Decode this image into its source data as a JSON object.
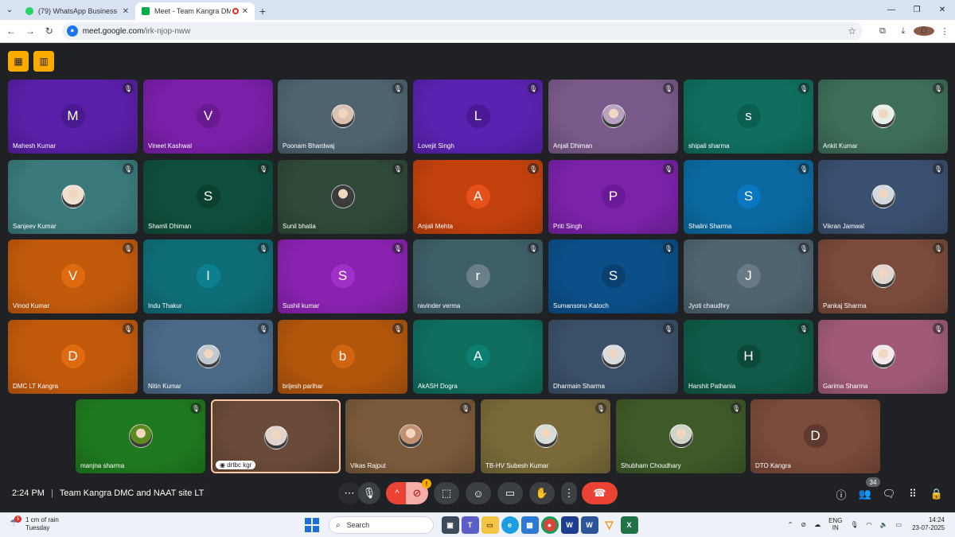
{
  "browser": {
    "tabs": [
      {
        "title": "(79) WhatsApp Business",
        "icon": "whatsapp-icon",
        "color": "#25d366",
        "active": false
      },
      {
        "title": "Meet - Team Kangra DMC a",
        "icon": "meet-icon",
        "color": "#00ac47",
        "active": true
      }
    ],
    "url_host": "meet.google.com",
    "url_path": "/irk-njop-nww",
    "profile_initial": "D"
  },
  "meeting": {
    "time": "2:24 PM",
    "name": "Team Kangra DMC and NAAT site LT",
    "participant_count": "34"
  },
  "participants": [
    {
      "name": "Mahesh Kumar",
      "initial": "M",
      "bg": "#5a1fa8",
      "av": "#4a1a90",
      "muted": true
    },
    {
      "name": "Vineet Kashwal",
      "initial": "V",
      "bg": "#7a1fa8",
      "av": "#6a1a90",
      "muted": false
    },
    {
      "name": "Poonam Bhardwaj",
      "initial": "",
      "bg": "#4d6470",
      "av": "#d9c3b0",
      "muted": true
    },
    {
      "name": "Lovejit Singh",
      "initial": "L",
      "bg": "#5a22b0",
      "av": "#4a1a96",
      "muted": true
    },
    {
      "name": "Anjali Dhiman",
      "initial": "",
      "bg": "#7a5a8a",
      "av": "#b7a3c0",
      "muted": true
    },
    {
      "name": "shipali sharma",
      "initial": "s",
      "bg": "#0f6e5e",
      "av": "#0b5f50",
      "muted": true
    },
    {
      "name": "Ankit Kumar",
      "initial": "",
      "bg": "#3d6e58",
      "av": "#e8eee8",
      "muted": true
    },
    {
      "name": "Sanjeev Kumar",
      "initial": "",
      "bg": "#3a7a7c",
      "av": "#f0e0d0",
      "muted": true
    },
    {
      "name": "Shamli Dhiman",
      "initial": "S",
      "bg": "#0f4e3c",
      "av": "#0b3f30",
      "muted": true
    },
    {
      "name": "Sunil bhatia",
      "initial": "",
      "bg": "#2f4a36",
      "av": "#3c3c3c",
      "muted": true
    },
    {
      "name": "Anjali Mehta",
      "initial": "A",
      "bg": "#c2410c",
      "av": "#e6501a",
      "muted": true
    },
    {
      "name": "Priti Singh",
      "initial": "P",
      "bg": "#7a22a8",
      "av": "#6a1a96",
      "muted": true
    },
    {
      "name": "Shalini Sharma",
      "initial": "S",
      "bg": "#0a6aa0",
      "av": "#0a78c0",
      "muted": true
    },
    {
      "name": "Vikran Jamwal",
      "initial": "",
      "bg": "#3a5070",
      "av": "#d0d8e0",
      "muted": true
    },
    {
      "name": "Vinod Kumar",
      "initial": "V",
      "bg": "#c25a0c",
      "av": "#e06a10",
      "muted": true
    },
    {
      "name": "Indu Thakur",
      "initial": "I",
      "bg": "#0e6e78",
      "av": "#0d8090",
      "muted": true
    },
    {
      "name": "Sushil kumar",
      "initial": "S",
      "bg": "#8a22b0",
      "av": "#a030c8",
      "muted": true
    },
    {
      "name": "ravinder verma",
      "initial": "r",
      "bg": "#3e5e68",
      "av": "#6a8088",
      "muted": true
    },
    {
      "name": "Sumansonu Katoch",
      "initial": "S",
      "bg": "#0a4f88",
      "av": "#0a4070",
      "muted": true
    },
    {
      "name": "Jyoti chaudhry",
      "initial": "J",
      "bg": "#4e6470",
      "av": "#6a7a84",
      "muted": true
    },
    {
      "name": "Pankaj Sharma",
      "initial": "",
      "bg": "#7a4a3a",
      "av": "#e0d6d0",
      "muted": true
    },
    {
      "name": "DMC LT Kangra",
      "initial": "D",
      "bg": "#c25a0c",
      "av": "#e06a10",
      "muted": true
    },
    {
      "name": "Nitin Kumar",
      "initial": "",
      "bg": "#4a6a88",
      "av": "#c0c8d0",
      "muted": true
    },
    {
      "name": "brijesh parihar",
      "initial": "b",
      "bg": "#b2560c",
      "av": "#d06410",
      "muted": true
    },
    {
      "name": "AkASH Dogra",
      "initial": "A",
      "bg": "#0e6e5e",
      "av": "#0b8070",
      "muted": false
    },
    {
      "name": "Dharmain Sharma",
      "initial": "",
      "bg": "#3a5068",
      "av": "#d8dcde",
      "muted": true
    },
    {
      "name": "Harshit Pathania",
      "initial": "H",
      "bg": "#0f5a48",
      "av": "#0b4a3a",
      "muted": true
    },
    {
      "name": "Garima Sharma",
      "initial": "",
      "bg": "#a05a78",
      "av": "#f4e8ea",
      "muted": true
    },
    {
      "name": "manjna sharma",
      "initial": "",
      "bg": "#1e7a1e",
      "av": "#5a8a20",
      "muted": true
    },
    {
      "name": "drtbc kgr",
      "initial": "",
      "bg": "#6a4a38",
      "av": "#e0d4cc",
      "muted": false,
      "self": true
    },
    {
      "name": "Vikas Rajput",
      "initial": "",
      "bg": "#7a5a3a",
      "av": "#c09070",
      "muted": true
    },
    {
      "name": "TB-HV Subesh Kumar",
      "initial": "",
      "bg": "#7a6a3a",
      "av": "#d8dcd8",
      "muted": true
    },
    {
      "name": "Shubham Choudhary",
      "initial": "",
      "bg": "#3e5a28",
      "av": "#cfd6c8",
      "muted": true
    },
    {
      "name": "DTO Kangra",
      "initial": "D",
      "bg": "#7a4a3a",
      "av": "#5e3a2e",
      "muted": false
    }
  ],
  "controls": {
    "more_label": "⋯",
    "mic": "🎙",
    "chevron": "^",
    "cam_warning": "!",
    "cam": "⊘",
    "present": "⬚",
    "emoji": "☺",
    "captions": "▭",
    "hand": "✋",
    "options": "⋮",
    "end_call": "☎"
  },
  "taskbar": {
    "weather_line1": "1 cm of rain",
    "weather_line2": "Tuesday",
    "weather_badge": "5",
    "search_placeholder": "Search",
    "lang_line1": "ENG",
    "lang_line2": "IN",
    "time": "14:24",
    "date": "23-07-2025"
  }
}
